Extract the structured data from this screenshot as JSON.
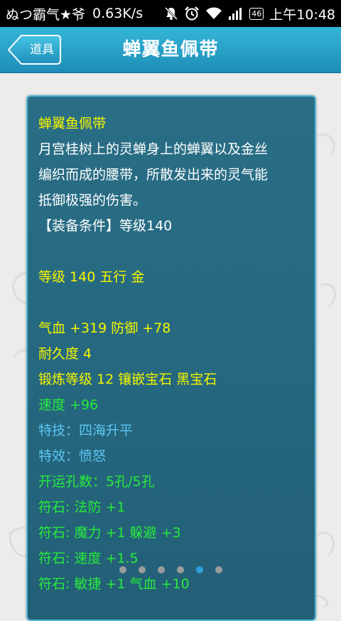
{
  "status_bar": {
    "left_text": "ぬつ霸气★爷",
    "speed": "0.63K/s",
    "network_badge": "46",
    "time": "上午10:48",
    "icons": [
      "notification-off-icon",
      "alarm-icon",
      "wifi-icon",
      "signal-icon"
    ]
  },
  "titlebar": {
    "back_label": "道具",
    "title": "蝉翼鱼佩带"
  },
  "item": {
    "lines": [
      {
        "text": "蝉翼鱼佩带",
        "color": "#f6f600"
      },
      {
        "text": "月宫桂树上的灵蝉身上的蝉翼以及金丝",
        "color": "#ffffff"
      },
      {
        "text": "编织而成的腰带，所散发出来的灵气能",
        "color": "#ffffff"
      },
      {
        "text": "抵御极强的伤害。",
        "color": "#ffffff"
      },
      {
        "text": "【装备条件】等级140",
        "color": "#ffffff"
      },
      {
        "text": "",
        "color": ""
      },
      {
        "text": "等级 140 五行 金",
        "color": "#f6f600"
      },
      {
        "text": "",
        "color": ""
      },
      {
        "text": "气血 +319 防御 +78",
        "color": "#f6f600"
      },
      {
        "text": "耐久度 4",
        "color": "#f6f600"
      },
      {
        "text": "锻炼等级 12 镶嵌宝石 黑宝石",
        "color": "#f6f600"
      },
      {
        "text": "速度 +96",
        "color": "#27ea3c"
      },
      {
        "text": "特技：四海升平",
        "color": "#5dc6f2"
      },
      {
        "text": "特效：愤怒",
        "color": "#5dc6f2"
      },
      {
        "text": "开运孔数：5孔/5孔",
        "color": "#27ea3c"
      },
      {
        "text": "符石: 法防 +1",
        "color": "#27ea3c"
      },
      {
        "text": "符石: 魔力 +1 躲避 +3",
        "color": "#27ea3c"
      },
      {
        "text": "符石: 速度 +1.5",
        "color": "#27ea3c"
      },
      {
        "text": "符石: 敏捷 +1 气血 +10",
        "color": "#27ea3c"
      }
    ]
  },
  "pager": {
    "total": 6,
    "active_index": 4
  }
}
